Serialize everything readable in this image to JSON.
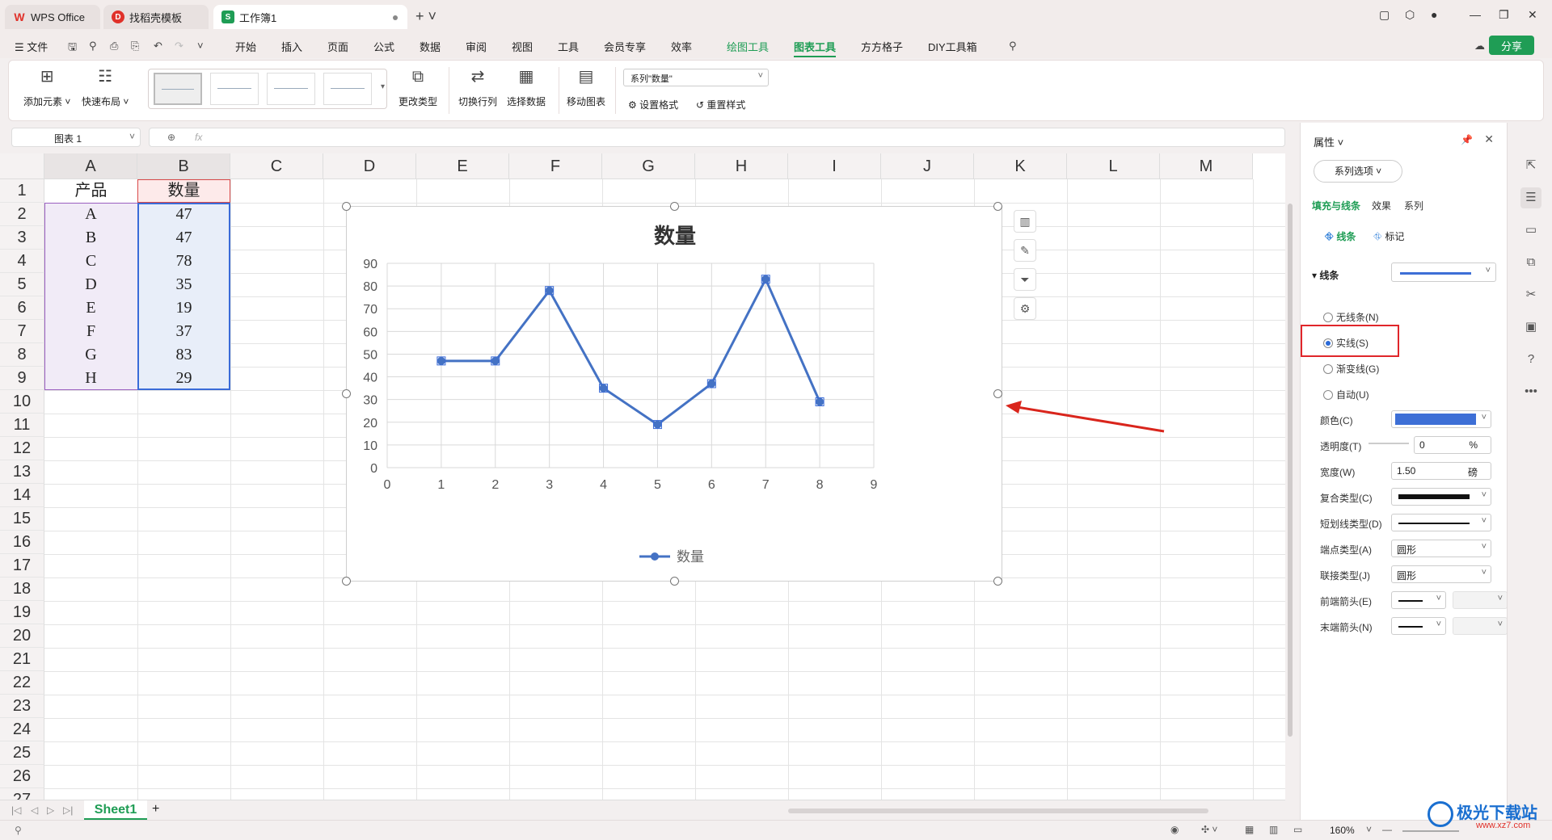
{
  "titlebar": {
    "tabs": [
      {
        "label": "WPS Office",
        "icon": "wps-logo-icon"
      },
      {
        "label": "找稻壳模板",
        "icon": "docer-icon"
      },
      {
        "label": "工作簿1",
        "icon": "spreadsheet-icon"
      }
    ]
  },
  "menubar": {
    "file": "文件",
    "items": [
      "开始",
      "插入",
      "页面",
      "公式",
      "数据",
      "审阅",
      "视图",
      "工具",
      "会员专享",
      "效率",
      "绘图工具",
      "图表工具",
      "方方格子",
      "DIY工具箱"
    ],
    "share": "分享"
  },
  "ribbon": {
    "add_element": "添加元素",
    "quick_layout": "快速布局",
    "change_type": "更改类型",
    "switch_rowcol": "切换行列",
    "select_data": "选择数据",
    "move_chart": "移动图表",
    "series_select": "系列\"数量\"",
    "set_format": "设置格式",
    "reset_style": "重置样式"
  },
  "formula": {
    "namebox": "图表 1",
    "fx": "fx"
  },
  "sheet": {
    "columns": [
      "A",
      "B",
      "C",
      "D",
      "E",
      "F",
      "G",
      "H",
      "I",
      "J",
      "K",
      "L",
      "M"
    ],
    "rows": [
      "1",
      "2",
      "3",
      "4",
      "5",
      "6",
      "7",
      "8",
      "9",
      "10",
      "11",
      "12",
      "13",
      "14",
      "15",
      "16",
      "17",
      "18",
      "19",
      "20",
      "21",
      "22",
      "23",
      "24",
      "25",
      "26",
      "27"
    ],
    "header": [
      "产品",
      "数量"
    ],
    "data": [
      [
        "A",
        "47"
      ],
      [
        "B",
        "47"
      ],
      [
        "C",
        "78"
      ],
      [
        "D",
        "35"
      ],
      [
        "E",
        "19"
      ],
      [
        "F",
        "37"
      ],
      [
        "G",
        "83"
      ],
      [
        "H",
        "29"
      ]
    ]
  },
  "chart_data": {
    "type": "line",
    "title": "数量",
    "x": [
      1,
      2,
      3,
      4,
      5,
      6,
      7,
      8
    ],
    "series": [
      {
        "name": "数量",
        "values": [
          47,
          47,
          78,
          35,
          19,
          37,
          83,
          29
        ],
        "color": "#4472c4"
      }
    ],
    "xlim": [
      0,
      9
    ],
    "ylim": [
      0,
      90
    ],
    "xticks": [
      0,
      1,
      2,
      3,
      4,
      5,
      6,
      7,
      8,
      9
    ],
    "yticks": [
      0,
      10,
      20,
      30,
      40,
      50,
      60,
      70,
      80,
      90
    ],
    "grid": true,
    "legend": "bottom"
  },
  "sheettabs": {
    "active": "Sheet1",
    "add": "+"
  },
  "status": {
    "zoom": "160%"
  },
  "props": {
    "title": "属性",
    "series_options": "系列选项",
    "tabs": [
      "填充与线条",
      "效果",
      "系列"
    ],
    "subtabs": [
      "线条",
      "标记"
    ],
    "line_section": "线条",
    "radios": [
      "无线条(N)",
      "实线(S)",
      "渐变线(G)",
      "自动(U)"
    ],
    "selected_radio": "实线(S)",
    "color_label": "颜色(C)",
    "line_color": "#3d6fd6",
    "transparency_label": "透明度(T)",
    "transparency_value": "0",
    "transparency_unit": "%",
    "width_label": "宽度(W)",
    "width_value": "1.50",
    "width_unit": "磅",
    "compound_label": "复合类型(C)",
    "dash_label": "短划线类型(D)",
    "cap_label": "端点类型(A)",
    "cap_value": "圆形",
    "join_label": "联接类型(J)",
    "join_value": "圆形",
    "begin_arrow_label": "前端箭头(E)",
    "end_arrow_label": "末端箭头(N)"
  },
  "watermark": {
    "brand": "极光下载站",
    "url": "www.xz7.com"
  }
}
